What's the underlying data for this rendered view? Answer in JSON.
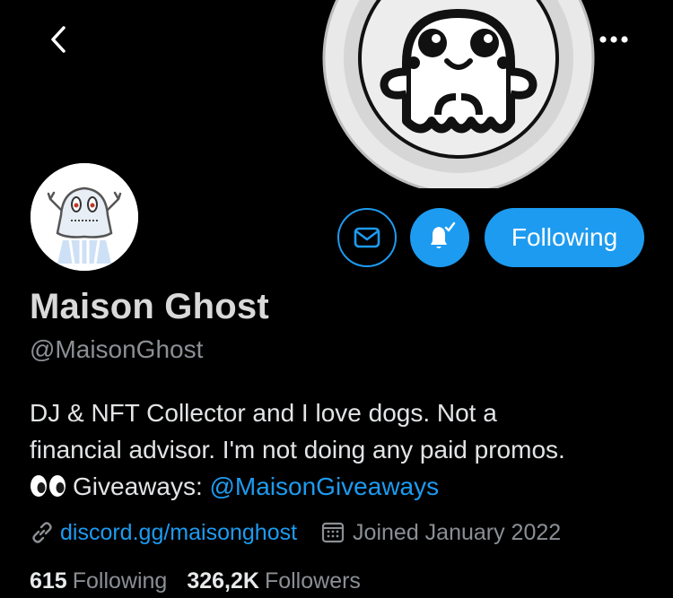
{
  "profile": {
    "display_name": "Maison Ghost",
    "handle": "@MaisonGhost",
    "bio_line1": "DJ & NFT Collector and I love dogs. Not a",
    "bio_line2": "financial advisor. I'm not doing any paid promos.",
    "bio_line3_prefix": "Giveaways: ",
    "bio_mention": "@MaisonGiveaways",
    "website": "discord.gg/maisonghost",
    "joined": "Joined January 2022"
  },
  "actions": {
    "follow_label": "Following"
  },
  "stats": {
    "following_count": "615",
    "following_label": "Following",
    "followers_count": "326,2K",
    "followers_label": "Followers"
  },
  "icons": {
    "back": "chevron-left-icon",
    "more": "ellipsis-icon",
    "message": "envelope-icon",
    "notify": "bell-check-icon",
    "link": "link-icon",
    "calendar": "calendar-icon",
    "eyes": "eyes-emoji-icon"
  },
  "colors": {
    "background": "#000000",
    "accent": "#1d9bf0",
    "secondary_text": "#8b8f94",
    "primary_text": "#e7e9ea"
  }
}
